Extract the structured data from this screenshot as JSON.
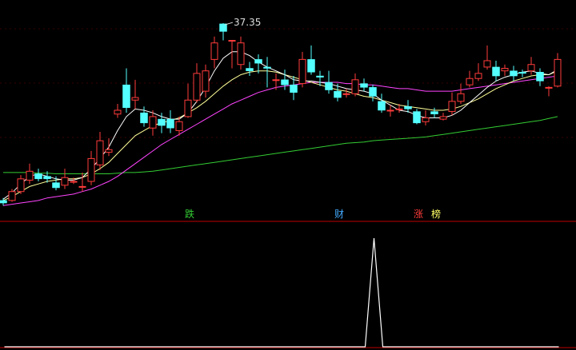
{
  "chart_data": {
    "type": "candlestick",
    "title": "",
    "max_label": "37.35",
    "colors": {
      "background": "#000000",
      "up": "#ff3b3b",
      "down": "#54ffff",
      "ma_short": "#ffffff",
      "ma_mid": "#ffff99",
      "ma_long": "#ff44ff",
      "ma_slow": "#33cc33",
      "separator": "#c00000",
      "indicator": "#ffffff"
    },
    "price_range": [
      22.7,
      38.8
    ],
    "candles": [
      [
        23.4,
        23.2,
        23.6,
        23.0
      ],
      [
        23.4,
        24.1,
        24.3,
        23.3
      ],
      [
        24.1,
        25.1,
        25.4,
        23.9
      ],
      [
        25.0,
        25.7,
        26.3,
        24.7
      ],
      [
        25.5,
        25.1,
        25.9,
        24.9
      ],
      [
        25.3,
        25.1,
        25.7,
        24.8
      ],
      [
        24.8,
        24.4,
        25.3,
        24.2
      ],
      [
        24.6,
        25.2,
        25.9,
        24.3
      ],
      [
        24.9,
        24.9,
        25.2,
        24.7
      ],
      [
        24.5,
        24.5,
        25.6,
        24.1
      ],
      [
        24.9,
        26.7,
        27.3,
        24.6
      ],
      [
        26.2,
        28.1,
        28.8,
        25.8
      ],
      [
        27.2,
        27.4,
        28.3,
        26.9
      ],
      [
        30.2,
        30.5,
        31.0,
        29.9
      ],
      [
        32.5,
        30.7,
        33.8,
        30.3
      ],
      [
        31.3,
        31.5,
        32.9,
        30.6
      ],
      [
        30.3,
        29.5,
        30.8,
        29.2
      ],
      [
        29.1,
        30.0,
        30.5,
        28.5
      ],
      [
        29.8,
        29.3,
        30.3,
        28.7
      ],
      [
        29.8,
        29.1,
        30.5,
        28.7
      ],
      [
        28.9,
        29.6,
        30.0,
        28.5
      ],
      [
        30.0,
        31.3,
        32.6,
        29.9
      ],
      [
        31.3,
        33.4,
        34.2,
        31.1
      ],
      [
        32.0,
        33.6,
        34.1,
        31.5
      ],
      [
        34.5,
        35.8,
        36.3,
        33.8
      ],
      [
        37.3,
        36.7,
        37.35,
        36.0
      ],
      [
        36.0,
        36.0,
        36.0,
        33.8
      ],
      [
        34.1,
        35.8,
        36.3,
        33.7
      ],
      [
        33.8,
        33.6,
        34.3,
        33.2
      ],
      [
        34.5,
        34.2,
        34.9,
        33.4
      ],
      [
        33.9,
        33.8,
        34.7,
        32.3
      ],
      [
        32.9,
        32.9,
        33.4,
        32.1
      ],
      [
        32.9,
        32.5,
        33.7,
        32.1
      ],
      [
        32.5,
        31.9,
        33.2,
        31.3
      ],
      [
        32.6,
        34.5,
        35.1,
        32.3
      ],
      [
        34.5,
        33.5,
        35.6,
        33.3
      ],
      [
        33.2,
        33.1,
        33.6,
        32.4
      ],
      [
        32.7,
        32.1,
        33.6,
        31.8
      ],
      [
        32.0,
        31.5,
        32.6,
        31.2
      ],
      [
        31.8,
        31.8,
        32.2,
        31.5
      ],
      [
        31.8,
        32.9,
        33.4,
        31.6
      ],
      [
        32.6,
        32.3,
        33.0,
        32.0
      ],
      [
        32.3,
        31.6,
        32.5,
        31.2
      ],
      [
        31.2,
        30.5,
        31.8,
        30.3
      ],
      [
        30.5,
        30.5,
        30.9,
        30.0
      ],
      [
        30.6,
        30.6,
        31.0,
        30.3
      ],
      [
        30.8,
        30.6,
        31.3,
        30.3
      ],
      [
        30.4,
        29.5,
        30.6,
        29.4
      ],
      [
        29.6,
        29.9,
        30.5,
        29.3
      ],
      [
        30.4,
        30.2,
        30.7,
        29.9
      ],
      [
        29.8,
        30.0,
        30.3,
        29.7
      ],
      [
        30.4,
        31.2,
        31.9,
        30.1
      ],
      [
        31.2,
        31.8,
        32.6,
        31.0
      ],
      [
        32.5,
        33.0,
        33.6,
        32.3
      ],
      [
        33.0,
        33.4,
        34.2,
        32.8
      ],
      [
        33.9,
        34.4,
        35.6,
        33.7
      ],
      [
        33.9,
        33.2,
        34.4,
        32.8
      ],
      [
        33.6,
        33.8,
        34.1,
        33.2
      ],
      [
        33.6,
        33.2,
        34.0,
        32.8
      ],
      [
        33.5,
        33.4,
        33.7,
        33.1
      ],
      [
        33.6,
        34.1,
        34.7,
        33.3
      ],
      [
        33.5,
        32.8,
        33.8,
        32.4
      ],
      [
        32.3,
        32.3,
        32.4,
        31.6
      ],
      [
        32.4,
        34.5,
        35.0,
        32.3
      ]
    ],
    "ma_short": [
      23.5,
      24.0,
      24.7,
      25.3,
      25.5,
      25.3,
      25.1,
      25.0,
      25.0,
      25.2,
      25.9,
      26.7,
      27.6,
      28.9,
      30.0,
      30.6,
      30.5,
      30.3,
      30.0,
      29.8,
      29.8,
      30.3,
      31.2,
      32.3,
      33.6,
      34.6,
      35.1,
      35.1,
      34.8,
      34.3,
      33.9,
      33.6,
      33.3,
      32.9,
      32.8,
      32.8,
      32.7,
      32.6,
      32.4,
      32.2,
      32.1,
      32.0,
      31.8,
      31.3,
      30.9,
      30.5,
      30.4,
      30.1,
      29.9,
      29.9,
      29.9,
      30.1,
      30.5,
      31.1,
      31.7,
      32.3,
      32.8,
      33.1,
      33.3,
      33.5,
      33.6,
      33.4,
      33.3,
      33.7
    ],
    "ma_mid": [
      23.4,
      23.7,
      24.1,
      24.5,
      24.7,
      24.9,
      25.0,
      25.1,
      25.1,
      25.2,
      25.5,
      25.9,
      26.4,
      27.1,
      27.8,
      28.5,
      28.9,
      29.3,
      29.5,
      29.7,
      29.9,
      30.3,
      30.7,
      31.2,
      31.8,
      32.4,
      32.9,
      33.3,
      33.5,
      33.6,
      33.6,
      33.5,
      33.3,
      33.1,
      32.9,
      32.7,
      32.5,
      32.3,
      32.1,
      32.0,
      31.8,
      31.6,
      31.5,
      31.3,
      31.1,
      30.9,
      30.8,
      30.7,
      30.6,
      30.5,
      30.5,
      30.6,
      30.8,
      31.1,
      31.4,
      31.8,
      32.2,
      32.5,
      32.8,
      33.0,
      33.2,
      33.3,
      33.3,
      33.6
    ],
    "ma_long": [
      23.0,
      23.1,
      23.2,
      23.3,
      23.4,
      23.6,
      23.7,
      23.8,
      23.9,
      24.1,
      24.3,
      24.6,
      24.9,
      25.3,
      25.8,
      26.3,
      26.8,
      27.3,
      27.8,
      28.2,
      28.6,
      29.0,
      29.4,
      29.8,
      30.2,
      30.6,
      31.0,
      31.3,
      31.6,
      31.9,
      32.1,
      32.3,
      32.4,
      32.5,
      32.6,
      32.7,
      32.7,
      32.7,
      32.7,
      32.6,
      32.6,
      32.5,
      32.5,
      32.4,
      32.3,
      32.2,
      32.2,
      32.1,
      32.0,
      32.0,
      32.0,
      32.0,
      32.1,
      32.2,
      32.3,
      32.4,
      32.5,
      32.6,
      32.7,
      32.8,
      32.9,
      33.0,
      33.1,
      33.2
    ],
    "ma_slow": [
      25.6,
      25.6,
      25.6,
      25.6,
      25.55,
      25.55,
      25.5,
      25.5,
      25.5,
      25.5,
      25.5,
      25.5,
      25.5,
      25.55,
      25.6,
      25.6,
      25.65,
      25.7,
      25.8,
      25.9,
      26.0,
      26.1,
      26.2,
      26.3,
      26.4,
      26.5,
      26.6,
      26.7,
      26.8,
      26.9,
      27.0,
      27.1,
      27.2,
      27.3,
      27.4,
      27.5,
      27.6,
      27.7,
      27.8,
      27.9,
      27.95,
      28.0,
      28.1,
      28.15,
      28.2,
      28.25,
      28.3,
      28.35,
      28.4,
      28.5,
      28.6,
      28.7,
      28.8,
      28.9,
      29.0,
      29.1,
      29.2,
      29.3,
      29.4,
      29.5,
      29.6,
      29.7,
      29.85,
      30.0
    ],
    "signals": [
      {
        "index": 21,
        "text": "跌",
        "color": "#33cc33"
      },
      {
        "index": 38,
        "text": "财",
        "color": "#44aaff"
      },
      {
        "index": 47,
        "text": "涨",
        "color": "#ff3b3b"
      },
      {
        "index": 49,
        "text": "榜",
        "color": "#ffff66"
      }
    ],
    "indicator": {
      "values": [
        0,
        0,
        0,
        0,
        0,
        0,
        0,
        0,
        0,
        0,
        0,
        0,
        0,
        0,
        0,
        0,
        0,
        0,
        0,
        0,
        0,
        0,
        0,
        0,
        0,
        0,
        0,
        0,
        0,
        0,
        0,
        0,
        0,
        0,
        0,
        0,
        0,
        0,
        0,
        0,
        0,
        0,
        1,
        0,
        0,
        0,
        0,
        0,
        0,
        0,
        0,
        0,
        0,
        0,
        0,
        0,
        0,
        0,
        0,
        0,
        0,
        0,
        0,
        0
      ],
      "range": [
        0,
        1
      ]
    }
  }
}
